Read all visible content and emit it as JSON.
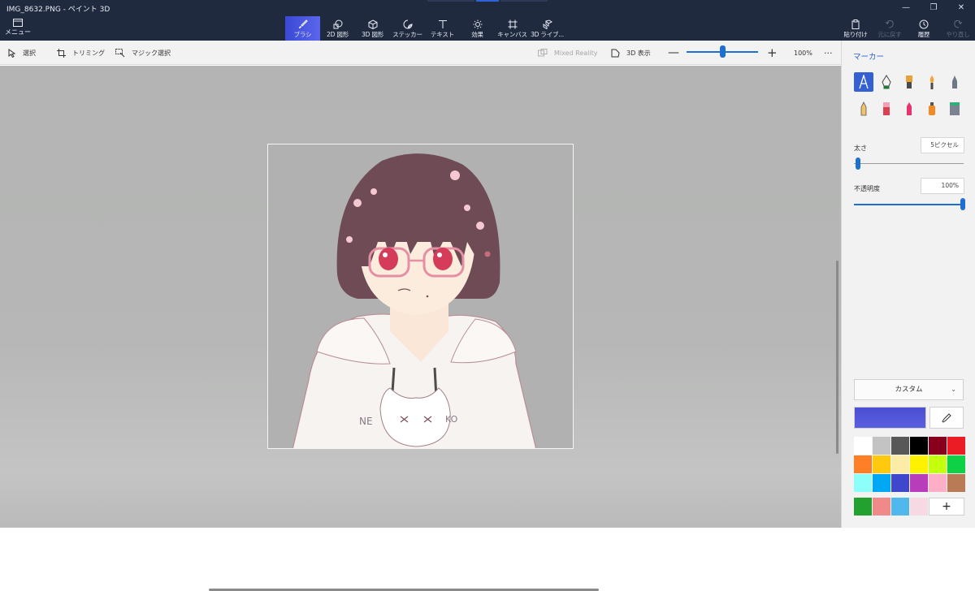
{
  "window": {
    "title": "IMG_8632.PNG - ペイント 3D",
    "controls": [
      "minimize-icon",
      "restore-icon",
      "close-icon"
    ]
  },
  "menu": {
    "label": "メニュー",
    "icon": "menu-icon"
  },
  "tools": [
    {
      "label": "ブラシ",
      "icon": "brush-icon",
      "active": true
    },
    {
      "label": "2D 図形",
      "icon": "shapes-2d-icon"
    },
    {
      "label": "3D 図形",
      "icon": "cube-icon"
    },
    {
      "label": "ステッカー",
      "icon": "sticker-icon"
    },
    {
      "label": "テキスト",
      "icon": "text-icon"
    },
    {
      "label": "効果",
      "icon": "sun-icon"
    },
    {
      "label": "キャンバス",
      "icon": "canvas-icon"
    },
    {
      "label": "3D ライブ...",
      "icon": "library-icon"
    }
  ],
  "right_commands": [
    {
      "label": "貼り付け",
      "icon": "paste-icon",
      "enabled": true
    },
    {
      "label": "元に戻す",
      "icon": "undo-icon",
      "enabled": false
    },
    {
      "label": "履歴",
      "icon": "history-icon",
      "enabled": true
    },
    {
      "label": "やり直し",
      "icon": "redo-icon",
      "enabled": false
    }
  ],
  "subtoolbar": {
    "select": "選択",
    "crop": "トリミング",
    "magic_select": "マジック選択",
    "mixed_reality": "Mixed Reality",
    "view_3d": "3D 表示",
    "zoom": "100%",
    "zoom_level": 0.5
  },
  "panel": {
    "title": "マーカー",
    "brushes": [
      "marker-icon",
      "calligraphy-pen-icon",
      "oil-brush-icon",
      "watercolor-icon",
      "pixel-pen-icon",
      "pencil-icon",
      "eraser-icon",
      "crayon-icon",
      "spray-can-icon",
      "fill-icon"
    ],
    "selected_brush": 0,
    "thickness_label": "太さ",
    "thickness_value": "5ピクセル",
    "thickness_level": 0.04,
    "opacity_label": "不透明度",
    "opacity_value": "100%",
    "opacity_level": 1.0,
    "color_mode": "カスタム",
    "current_color": "#4a4ed0",
    "palette": [
      "#ffffff",
      "#c3c3c3",
      "#585858",
      "#000000",
      "#88001b",
      "#ec1c24",
      "#ff7f27",
      "#ffc90e",
      "#fdeca6",
      "#fff200",
      "#c4ff0e",
      "#0ed145",
      "#8cfffb",
      "#00a8f3",
      "#3f48cc",
      "#b83dba",
      "#ffaec8",
      "#b97a56"
    ],
    "custom_colors": [
      "#22a12e",
      "#f08a8a",
      "#4fb8ec",
      "#f7d9e4"
    ],
    "add_label": "+"
  },
  "colors": {
    "titlebar": "#1f2a3e",
    "accent": "#1f6fd0",
    "active_tool": "#3a49d6"
  }
}
